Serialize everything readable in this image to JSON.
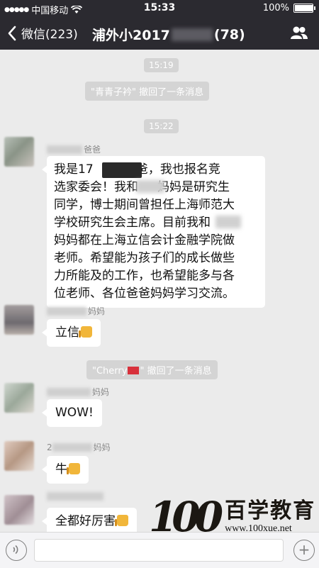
{
  "status_bar": {
    "carrier": "中国移动",
    "time": "15:33",
    "battery_text": "100%",
    "battery_level": 1.0
  },
  "nav": {
    "back_label": "微信(223)",
    "title_prefix": "浦外小2017",
    "title_count": "(78)",
    "icons": [
      "chevron-left-icon",
      "people-icon"
    ]
  },
  "chat": {
    "times": [
      "15:19",
      "15:22"
    ],
    "system_messages": [
      {
        "text": "\"青青子衿\" 撤回了一条消息"
      },
      {
        "before": "\"Cherry",
        "after": "\" 撤回了一条消息"
      }
    ],
    "messages": [
      {
        "sender": "爸爸",
        "lines": [
          "我是17        爸爸，我也报名竞",
          "选家委会！我和     妈妈是研究生",
          "同学，博士期间曾担任上海师范大",
          "学校研究生会主席。目前我和",
          "妈妈都在上海立信会计金融学院做",
          "老师。希望能为孩子们的成长做些",
          "力所能及的工作，也希望能多与各",
          "位老师、各位爸爸妈妈学习交流。"
        ]
      },
      {
        "sender": "妈妈",
        "text": "立信"
      },
      {
        "sender": "妈妈",
        "text": "WOW!"
      },
      {
        "sender_prefix": "2",
        "sender": "妈妈",
        "text": "牛"
      },
      {
        "sender": "",
        "text": "全都好厉害"
      }
    ]
  },
  "input_bar": {
    "icons": [
      "voice-icon",
      "plus-icon"
    ]
  },
  "watermark": {
    "number": "100",
    "brand": "百学教育",
    "url": "www.100xue.net"
  },
  "colors": {
    "bar_bg": "#2b2a30",
    "chat_bg": "#ebebeb",
    "pill_bg": "#d4d4d4",
    "bubble_bg": "#ffffff"
  }
}
